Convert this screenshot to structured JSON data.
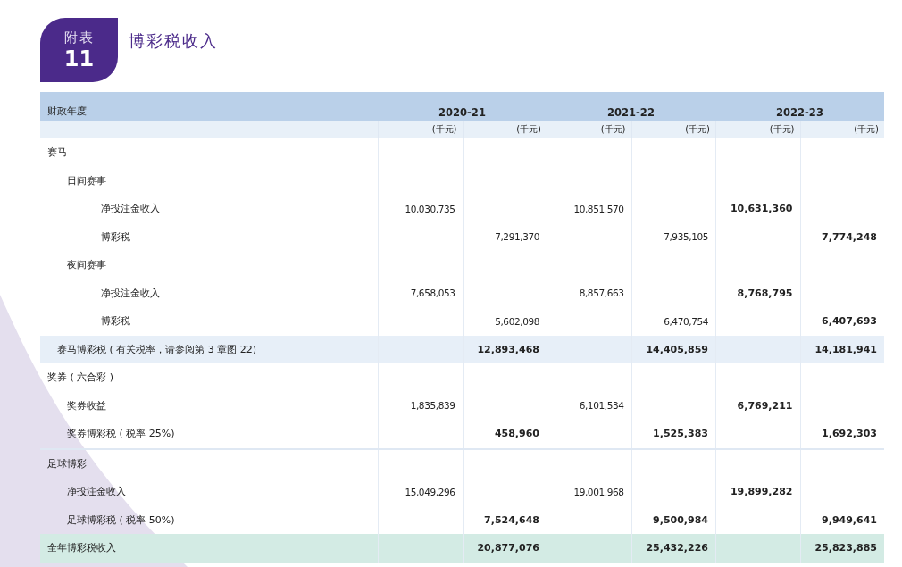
{
  "badge": {
    "label": "附表",
    "number": "11"
  },
  "title": "博彩税收入",
  "table": {
    "first_header": "财政年度",
    "years": [
      "2020-21",
      "2021-22",
      "2022-23"
    ],
    "units": [
      "(千元)",
      "(千元)",
      "(千元)",
      "(千元)",
      "(千元)",
      "(千元)"
    ],
    "rows": [
      {
        "label": "赛马",
        "children": [
          {
            "label": "日间赛事",
            "children": [
              {
                "label": "净投注金收入",
                "cells": [
                  {
                    "text": "10,030,735",
                    "bold": false
                  },
                  null,
                  {
                    "text": "10,851,570",
                    "bold": false
                  },
                  null,
                  {
                    "text": "10,631,360",
                    "bold": true
                  },
                  null
                ]
              },
              {
                "label": "博彩税",
                "cells": [
                  null,
                  {
                    "text": "7,291,370",
                    "bold": false
                  },
                  null,
                  {
                    "text": "7,935,105",
                    "bold": false
                  },
                  null,
                  {
                    "text": "7,774,248",
                    "bold": true
                  }
                ]
              }
            ]
          },
          {
            "label": "夜间赛事",
            "children": [
              {
                "label": "净投注金收入",
                "cells": [
                  {
                    "text": "7,658,053",
                    "bold": false
                  },
                  null,
                  {
                    "text": "8,857,663",
                    "bold": false
                  },
                  null,
                  {
                    "text": "8,768,795",
                    "bold": true
                  },
                  null
                ]
              },
              {
                "label": "博彩税",
                "cells": [
                  null,
                  {
                    "text": "5,602,098",
                    "bold": false
                  },
                  null,
                  {
                    "text": "6,470,754",
                    "bold": false
                  },
                  null,
                  {
                    "text": "6,407,693",
                    "bold": true
                  }
                ]
              }
            ]
          }
        ]
      },
      {
        "kind": "subtotal",
        "label": "赛马博彩税 ( 有关税率，请参阅第 3 章图 22)",
        "cells": [
          null,
          {
            "text": "12,893,468",
            "bold": true
          },
          null,
          {
            "text": "14,405,859",
            "bold": true
          },
          null,
          {
            "text": "14,181,941",
            "bold": true
          }
        ]
      },
      {
        "label": "奖券 ( 六合彩 )",
        "children": [
          {
            "label": "奖券收益",
            "cells": [
              {
                "text": "1,835,839",
                "bold": false
              },
              null,
              {
                "text": "6,101,534",
                "bold": false
              },
              null,
              {
                "text": "6,769,211",
                "bold": true
              },
              null
            ]
          },
          {
            "label": "奖券博彩税 ( 税率 25%)",
            "cells": [
              null,
              {
                "text": "458,960",
                "bold": true
              },
              null,
              {
                "text": "1,525,383",
                "bold": true
              },
              null,
              {
                "text": "1,692,303",
                "bold": true
              }
            ]
          }
        ]
      },
      {
        "label": "足球博彩",
        "children": [
          {
            "label": "净投注金收入",
            "cells": [
              {
                "text": "15,049,296",
                "bold": false
              },
              null,
              {
                "text": "19,001,968",
                "bold": false
              },
              null,
              {
                "text": "19,899,282",
                "bold": true
              },
              null
            ]
          },
          {
            "label": "足球博彩税 ( 税率 50%)",
            "cells": [
              null,
              {
                "text": "7,524,648",
                "bold": true
              },
              null,
              {
                "text": "9,500,984",
                "bold": true
              },
              null,
              {
                "text": "9,949,641",
                "bold": true
              }
            ]
          }
        ]
      },
      {
        "kind": "total",
        "label": "全年博彩税收入",
        "cells": [
          null,
          {
            "text": "20,877,076",
            "bold": true
          },
          null,
          {
            "text": "25,432,226",
            "bold": true
          },
          null,
          {
            "text": "25,823,885",
            "bold": true
          }
        ]
      }
    ]
  }
}
